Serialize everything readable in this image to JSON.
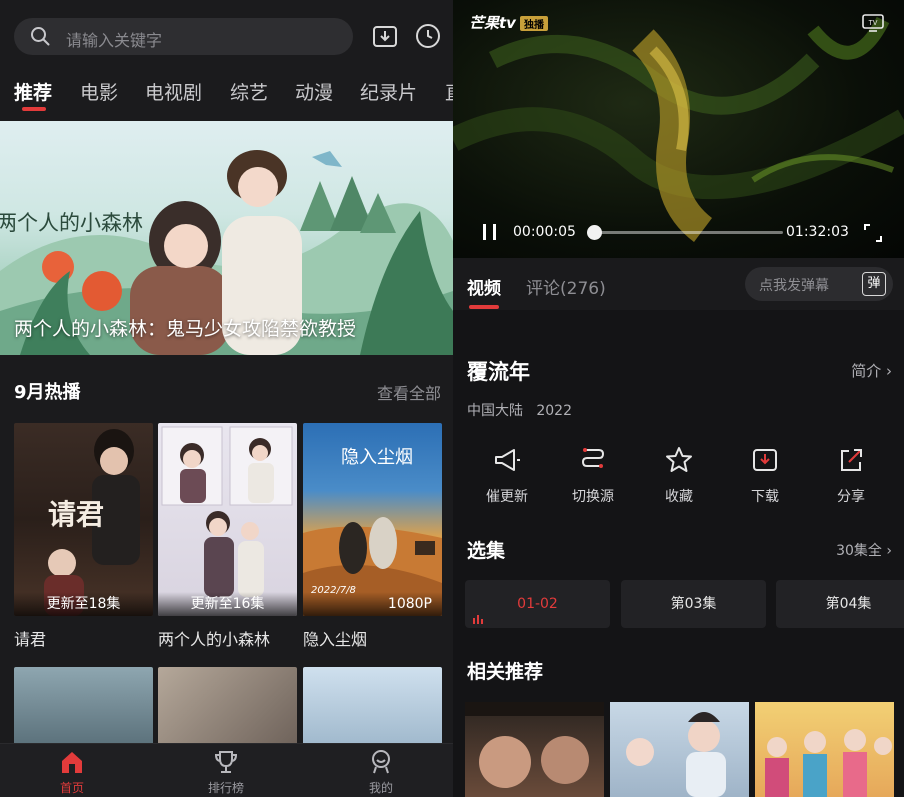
{
  "left": {
    "search": {
      "placeholder": "请输入关键字"
    },
    "header_icons": [
      "download-icon",
      "history-clock-icon"
    ],
    "tabs": [
      {
        "label": "推荐",
        "active": true
      },
      {
        "label": "电影"
      },
      {
        "label": "电视剧"
      },
      {
        "label": "综艺"
      },
      {
        "label": "动漫"
      },
      {
        "label": "纪录片"
      },
      {
        "label": "直"
      }
    ],
    "banner": {
      "caption": "两个人的小森林：鬼马少女攻陷禁欲教授",
      "art_text": "两个人的小森林"
    },
    "section": {
      "title": "9月热播",
      "more": "查看全部"
    },
    "posters": [
      {
        "title": "请君",
        "badge": "更新至18集",
        "art_text": "请君"
      },
      {
        "title": "两个人的小森林",
        "badge": "更新至16集"
      },
      {
        "title": "隐入尘烟",
        "badge": "1080P",
        "art_text": "隐入尘烟",
        "date": "2022/7/8"
      }
    ],
    "nav": [
      {
        "label": "首页",
        "icon": "home-icon",
        "active": true
      },
      {
        "label": "排行榜",
        "icon": "trophy-icon"
      },
      {
        "label": "我的",
        "icon": "profile-icon"
      }
    ]
  },
  "right": {
    "player": {
      "logo": "芒果tv",
      "logo_tag": "独播",
      "time_current": "00:00:05",
      "time_total": "01:32:03",
      "progress": 0.001
    },
    "tabs": [
      {
        "label": "视频",
        "active": true
      },
      {
        "label": "评论(276)"
      }
    ],
    "danmu": {
      "placeholder": "点我发弹幕",
      "button": "弹"
    },
    "show": {
      "title": "覆流年",
      "intro": "简介",
      "region": "中国大陆",
      "year": "2022"
    },
    "actions": [
      {
        "label": "催更新",
        "icon": "megaphone-icon"
      },
      {
        "label": "切换源",
        "icon": "switch-source-icon"
      },
      {
        "label": "收藏",
        "icon": "star-icon"
      },
      {
        "label": "下载",
        "icon": "download-icon"
      },
      {
        "label": "分享",
        "icon": "share-icon"
      }
    ],
    "episodes": {
      "title": "选集",
      "more": "30集全",
      "items": [
        {
          "label": "01-02",
          "active": true
        },
        {
          "label": "第03集"
        },
        {
          "label": "第04集"
        }
      ]
    },
    "related": {
      "title": "相关推荐"
    }
  },
  "colors": {
    "accent": "#e23b3b",
    "bg_dark": "#141416",
    "panel": "#1b1b1d"
  }
}
